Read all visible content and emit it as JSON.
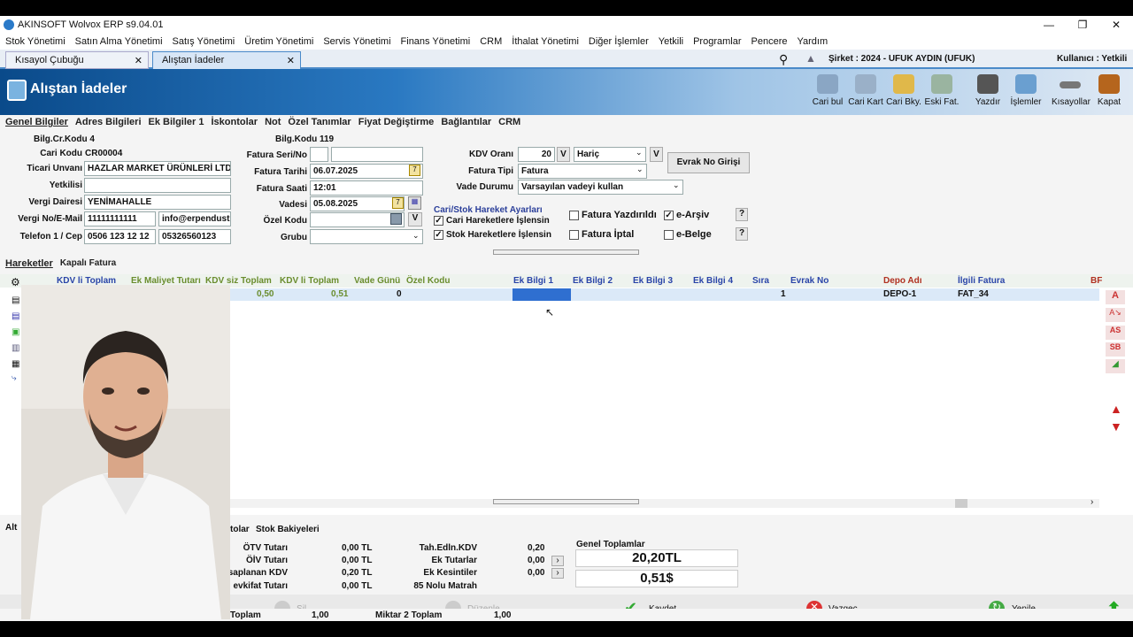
{
  "window": {
    "title": "AKINSOFT Wolvox ERP s9.04.01"
  },
  "menu": [
    "Stok Yönetimi",
    "Satın Alma Yönetimi",
    "Satış Yönetimi",
    "Üretim Yönetimi",
    "Servis Yönetimi",
    "Finans Yönetimi",
    "CRM",
    "İthalat Yönetimi",
    "Diğer İşlemler",
    "Yetkili",
    "Programlar",
    "Pencere",
    "Yardım"
  ],
  "tabs": [
    "Kısayol Çubuğu",
    "Alıştan İadeler"
  ],
  "company": "Şirket : 2024 - UFUK AYDIN (UFUK)",
  "user": "Kullanıcı : Yetkili",
  "header": {
    "title": "Alıştan İadeler"
  },
  "toolbar": [
    "Cari bul",
    "Cari Kart",
    "Cari Bky.",
    "Eski Fat.",
    "Yazdır",
    "İşlemler",
    "Kısayollar",
    "Kapat"
  ],
  "subtabs": [
    "Genel Bilgiler",
    "Adres Bilgileri",
    "Ek Bilgiler 1",
    "İskontolar",
    "Not",
    "Özel Tanımlar",
    "Fiyat Değiştirme",
    "Bağlantılar",
    "CRM"
  ],
  "form": {
    "bilg_cr_kodu": "Bilg.Cr.Kodu 4",
    "cari_kodu_label": "Cari Kodu",
    "cari_kodu": "CR00004",
    "ticari_unvan_label": "Ticari Unvanı",
    "ticari_unvan": "HAZLAR MARKET ÜRÜNLERİ LTD ŞT",
    "yetkilisi_label": "Yetkilisi",
    "vergi_dairesi_label": "Vergi Dairesi",
    "vergi_dairesi": "YENİMAHALLE",
    "vergi_no_label": "Vergi No/E-Mail",
    "vergi_no": "11111111111",
    "email": "info@erpendusti",
    "telefon_label": "Telefon 1 / Cep",
    "telefon": "0506 123 12 12",
    "cep": "05326560123",
    "bilg_kodu": "Bilg.Kodu 119",
    "seri_no_label": "Fatura Seri/No",
    "fatura_tarihi_label": "Fatura Tarihi",
    "fatura_tarihi": "06.07.2025",
    "fatura_saati_label": "Fatura Saati",
    "fatura_saati": "12:01",
    "vadesi_label": "Vadesi",
    "vadesi": "05.08.2025",
    "ozel_kodu_label": "Özel Kodu",
    "grubu_label": "Grubu",
    "kdv_orani_label": "KDV Oranı",
    "kdv_orani": "20",
    "kdv_tip": "Hariç",
    "fatura_tipi_label": "Fatura Tipi",
    "fatura_tipi": "Fatura",
    "vade_durumu_label": "Vade Durumu",
    "vade_durumu": "Varsayılan vadeyi kullan",
    "evrak_btn": "Evrak No Girişi",
    "v": "V",
    "hareket_group": "Cari/Stok Hareket Ayarları",
    "cari_hareket": "Cari Hareketlere İşlensin",
    "stok_hareket": "Stok Hareketlere İşlensin",
    "fatura_yazdirildi": "Fatura Yazdırıldı",
    "e_arsiv": "e-Arşiv",
    "fatura_iptal": "Fatura İptal",
    "e_belge": "e-Belge",
    "help": "?"
  },
  "grid_tabs": [
    "Hareketler",
    "Kapalı Fatura"
  ],
  "grid": {
    "columns": [
      "KDV li Toplam",
      "Ek Maliyet Tutarı",
      "KDV siz Toplam",
      "KDV li Toplam",
      "Vade Günü",
      "Özel Kodu",
      "Ek Bilgi 1",
      "Ek Bilgi 2",
      "Ek Bilgi 3",
      "Ek Bilgi 4",
      "Sıra",
      "Evrak No",
      "Depo Adı",
      "İlgili Fatura",
      "BF"
    ],
    "row": [
      "0,50",
      "0,51",
      "0",
      "1",
      "DEPO-1",
      "FAT_34"
    ]
  },
  "side_buttons": [
    "A",
    "AS",
    "SB"
  ],
  "bottom": {
    "tabs": [
      "Alt",
      "tolar",
      "Stok Bakiyeleri"
    ],
    "otv_label": "ÖTV Tutarı",
    "otv": "0,00 TL",
    "oiv_label": "ÖİV Tutarı",
    "oiv": "0,00 TL",
    "kdv_label": "esaplanan KDV",
    "kdv": "0,20 TL",
    "tevkifat_label": "evkifat Tutarı",
    "tevkifat": "0,00 TL",
    "tah_label": "Tah.Edln.KDV",
    "tah": "0,20",
    "ek_tutar_label": "Ek Tutarlar",
    "ek_tutar": "0,00",
    "ek_kesinti_label": "Ek Kesintiler",
    "ek_kesinti": "0,00",
    "matrah_label": "85 Nolu Matrah",
    "genel_label": "Genel Toplamlar",
    "genel_tl": "20,20TL",
    "genel_usd": "0,51$",
    "sil": "Sil",
    "duzenle": "Düzenle",
    "kaydet": "Kaydet",
    "vazgec": "Vazgeç",
    "yenile": "Yenile",
    "toplam_label": "Toplam",
    "toplam": "1,00",
    "miktar2_label": "Miktar 2 Toplam",
    "miktar2": "1,00"
  }
}
